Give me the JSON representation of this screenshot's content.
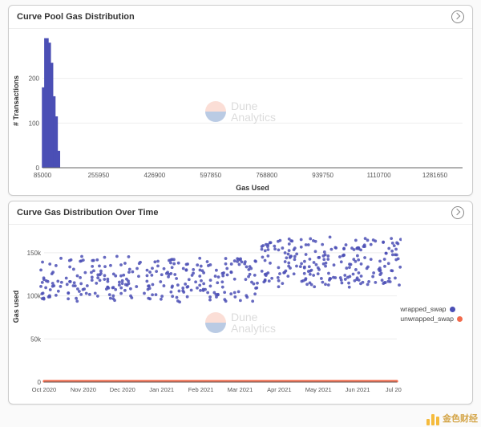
{
  "watermark_primary": "Dune",
  "watermark_secondary": "Analytics",
  "attribution": "金色财经",
  "chart1": {
    "title": "Curve Pool Gas Distribution",
    "xlabel": "Gas Used",
    "ylabel": "# Transactions"
  },
  "chart2": {
    "title": "Curve Gas Distribution Over Time",
    "xlabel": "",
    "ylabel": "Gas used",
    "legend1": "wrapped_swap",
    "legend2": "unwrapped_swap"
  },
  "chart_data": [
    {
      "type": "bar",
      "title": "Curve Pool Gas Distribution",
      "xlabel": "Gas Used",
      "ylabel": "# Transactions",
      "xlim": [
        85000,
        1366000
      ],
      "ylim": [
        0,
        300
      ],
      "xticks": [
        85000,
        255950,
        426900,
        597850,
        768800,
        939750,
        1110700,
        1281650
      ],
      "yticks": [
        0,
        100,
        200
      ],
      "bars": [
        {
          "x": 90000,
          "y": 180
        },
        {
          "x": 97000,
          "y": 290
        },
        {
          "x": 104000,
          "y": 280
        },
        {
          "x": 111000,
          "y": 235
        },
        {
          "x": 118000,
          "y": 160
        },
        {
          "x": 125000,
          "y": 115
        },
        {
          "x": 132000,
          "y": 38
        }
      ]
    },
    {
      "type": "scatter",
      "title": "Curve Gas Distribution Over Time",
      "ylabel": "Gas used",
      "ylim": [
        0,
        175000
      ],
      "yticks": [
        0,
        50000,
        100000,
        150000
      ],
      "xticks": [
        "Oct 2020",
        "Nov 2020",
        "Dec 2020",
        "Jan 2021",
        "Feb 2021",
        "Mar 2021",
        "Apr 2021",
        "May 2021",
        "Jun 2021",
        "Jul 2021"
      ],
      "series": [
        {
          "name": "wrapped_swap",
          "color": "#4b4fb5",
          "note": "dense cloud of per-day gas usage points; approx 100k–140k Oct2020–Mar2021, shifting to 120k–165k Apr2021–Jul2021",
          "sample_points": [
            {
              "x": "Oct 2020",
              "y": 105000
            },
            {
              "x": "Oct 2020",
              "y": 118000
            },
            {
              "x": "Oct 2020",
              "y": 140000
            },
            {
              "x": "Oct 2020",
              "y": 98000
            },
            {
              "x": "Nov 2020",
              "y": 110000
            },
            {
              "x": "Nov 2020",
              "y": 122000
            },
            {
              "x": "Nov 2020",
              "y": 130000
            },
            {
              "x": "Dec 2020",
              "y": 105000
            },
            {
              "x": "Dec 2020",
              "y": 128000
            },
            {
              "x": "Dec 2020",
              "y": 115000
            },
            {
              "x": "Jan 2021",
              "y": 112000
            },
            {
              "x": "Jan 2021",
              "y": 125000
            },
            {
              "x": "Jan 2021",
              "y": 136000
            },
            {
              "x": "Feb 2021",
              "y": 108000
            },
            {
              "x": "Feb 2021",
              "y": 120000
            },
            {
              "x": "Feb 2021",
              "y": 140000
            },
            {
              "x": "Mar 2021",
              "y": 118000
            },
            {
              "x": "Mar 2021",
              "y": 128000
            },
            {
              "x": "Mar 2021",
              "y": 142000
            },
            {
              "x": "Apr 2021",
              "y": 125000
            },
            {
              "x": "Apr 2021",
              "y": 145000
            },
            {
              "x": "Apr 2021",
              "y": 158000
            },
            {
              "x": "May 2021",
              "y": 130000
            },
            {
              "x": "May 2021",
              "y": 150000
            },
            {
              "x": "May 2021",
              "y": 162000
            },
            {
              "x": "Jun 2021",
              "y": 128000
            },
            {
              "x": "Jun 2021",
              "y": 148000
            },
            {
              "x": "Jun 2021",
              "y": 160000
            },
            {
              "x": "Jul 2021",
              "y": 132000
            },
            {
              "x": "Jul 2021",
              "y": 150000
            },
            {
              "x": "Jul 2021",
              "y": 163000
            }
          ]
        },
        {
          "name": "unwrapped_swap",
          "color": "#f26a4b",
          "note": "flat near zero across full range",
          "sample_points": [
            {
              "x": "Oct 2020",
              "y": 1000
            },
            {
              "x": "Nov 2020",
              "y": 1000
            },
            {
              "x": "Dec 2020",
              "y": 1000
            },
            {
              "x": "Jan 2021",
              "y": 1000
            },
            {
              "x": "Feb 2021",
              "y": 1000
            },
            {
              "x": "Mar 2021",
              "y": 1000
            },
            {
              "x": "Apr 2021",
              "y": 1000
            },
            {
              "x": "May 2021",
              "y": 1000
            },
            {
              "x": "Jun 2021",
              "y": 1000
            },
            {
              "x": "Jul 2021",
              "y": 1000
            }
          ]
        }
      ]
    }
  ]
}
